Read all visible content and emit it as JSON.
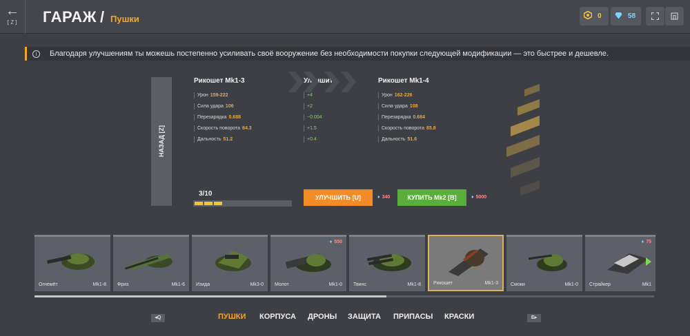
{
  "header": {
    "back_key": "[Z]",
    "title": "ГАРАЖ",
    "slash": "/",
    "subtitle": "Пушки",
    "rank_value": "0",
    "crystals_value": "58"
  },
  "info": {
    "text": "Благодаря улучшениям ты можешь постепенно усиливать своё вооружение без необходимости покупки следующей модификации — это быстрее и дешевле."
  },
  "upgrade": {
    "back_label": "НАЗАД [Z]",
    "current": {
      "title": "Рикошет Mk1-3",
      "stats": [
        {
          "label": "Урон",
          "value": "159-222"
        },
        {
          "label": "Сила удара",
          "value": "106"
        },
        {
          "label": "Перезарядка",
          "value": "0.688"
        },
        {
          "label": "Скорость поворота",
          "value": "84.3"
        },
        {
          "label": "Дальность",
          "value": "51.2"
        }
      ]
    },
    "diff": {
      "title": "Улучшить",
      "values": [
        "+4",
        "+2",
        "−0.004",
        "+1.5",
        "+0.4"
      ]
    },
    "next": {
      "title": "Рикошет Mk1-4",
      "stats": [
        {
          "label": "Урон",
          "value": "162-226"
        },
        {
          "label": "Сила удара",
          "value": "108"
        },
        {
          "label": "Перезарядка",
          "value": "0.684"
        },
        {
          "label": "Скорость поворота",
          "value": "85.8"
        },
        {
          "label": "Дальность",
          "value": "51.6"
        }
      ]
    },
    "progress_label": "3/10",
    "progress_done": 3,
    "progress_total": 10,
    "upgrade_button": "УЛУЧШИТЬ [U]",
    "upgrade_price": "340",
    "buy_button": "КУПИТЬ Mk2 [B]",
    "buy_price": "5000"
  },
  "items": [
    {
      "name": "Огнемёт",
      "mk": "Mk1-8",
      "price": ""
    },
    {
      "name": "Фриз",
      "mk": "Mk1-6",
      "price": ""
    },
    {
      "name": "Изида",
      "mk": "Mk3-0",
      "price": ""
    },
    {
      "name": "Молот",
      "mk": "Mk1-0",
      "price": "550"
    },
    {
      "name": "Твинс",
      "mk": "Mk1-8",
      "price": ""
    },
    {
      "name": "Рикошет",
      "mk": "Mk1-3",
      "price": "",
      "selected": true
    },
    {
      "name": "Смоки",
      "mk": "Mk1-0",
      "price": ""
    },
    {
      "name": "Страйкер",
      "mk": "Mk1",
      "price": "75"
    }
  ],
  "tabs": {
    "left_key": "Q",
    "right_key": "E",
    "items": [
      "ПУШКИ",
      "КОРПУСА",
      "ДРОНЫ",
      "ЗАЩИТА",
      "ПРИПАСЫ",
      "КРАСКИ"
    ]
  },
  "colors": {
    "accent": "#f5a623",
    "upgrade": "#f28c28",
    "buy": "#5aaf3c",
    "diff": "#7ed957"
  }
}
